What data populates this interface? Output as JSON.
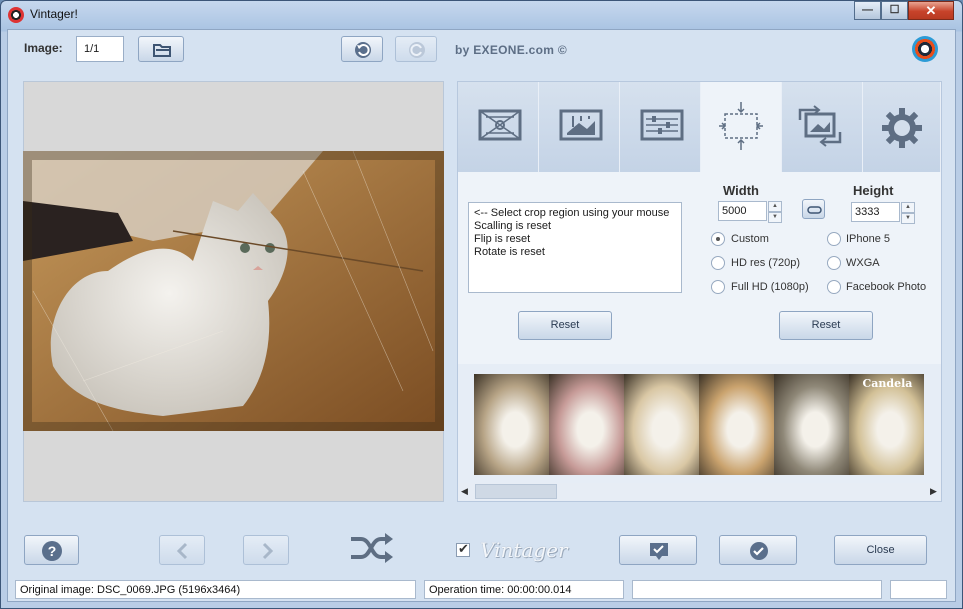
{
  "window": {
    "title": "Vintager!",
    "minimize_glyph": "—",
    "maximize_glyph": "☐",
    "close_glyph": "✕"
  },
  "toolbar": {
    "image_label": "Image:",
    "image_value": "1/1",
    "byline": "by EXEONE.com ©"
  },
  "tabs": [
    {
      "name": "tab-frame",
      "icon": "frame-icon",
      "active": false
    },
    {
      "name": "tab-adjustments",
      "icon": "image-adjust-icon",
      "active": false
    },
    {
      "name": "tab-sliders",
      "icon": "sliders-icon",
      "active": false
    },
    {
      "name": "tab-crop",
      "icon": "crop-icon",
      "active": true
    },
    {
      "name": "tab-rotate",
      "icon": "rotate-icon",
      "active": false
    },
    {
      "name": "tab-settings",
      "icon": "gear-icon",
      "active": false
    }
  ],
  "crop": {
    "messages": [
      "<-- Select crop region using your mouse",
      "",
      "Scalling is reset",
      "Flip is reset",
      "Rotate is reset"
    ],
    "width_label": "Width",
    "height_label": "Height",
    "width_value": "5000",
    "height_value": "3333",
    "presets_left": [
      {
        "label": "Custom",
        "checked": true
      },
      {
        "label": "HD res (720p)",
        "checked": false
      },
      {
        "label": "Full HD (1080p)",
        "checked": false
      }
    ],
    "presets_right": [
      {
        "label": "IPhone 5",
        "checked": false
      },
      {
        "label": "WXGA",
        "checked": false
      },
      {
        "label": "Facebook Photo",
        "checked": false
      }
    ],
    "reset_left": "Reset",
    "reset_right": "Reset"
  },
  "filters": {
    "selected_label": "Candela",
    "thumb_tints": [
      "#b7a486",
      "#c69a97",
      "#d9c7a4",
      "#caa36e",
      "#8f8878",
      "#d2c096"
    ]
  },
  "bottom": {
    "close_label": "Close",
    "vintager_checked": true,
    "vintager_logo": "Vintager"
  },
  "status": {
    "original": "Original image: DSC_0069.JPG (5196x3464)",
    "operation": "Operation time: 00:00:00.014",
    "extra1": "",
    "extra2": ""
  }
}
